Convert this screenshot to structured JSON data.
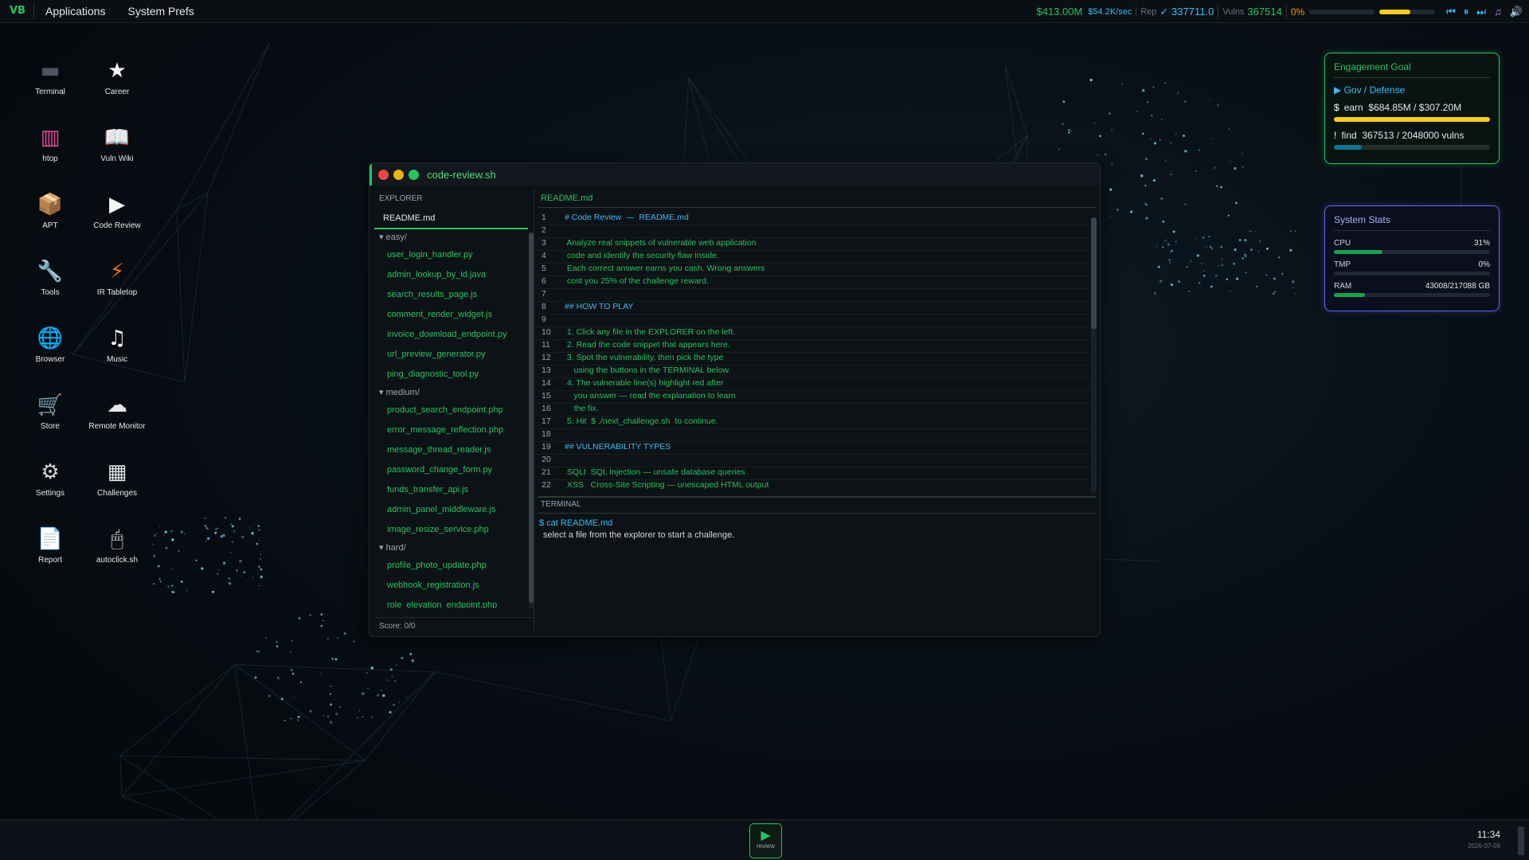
{
  "topbar": {
    "logo": "VB",
    "menu": [
      "Applications",
      "System Prefs"
    ],
    "money": "$413.00M",
    "rate": "$54.2K/sec",
    "rep_label": "Rep",
    "rep_value": "✓ 337711.0",
    "vulns_label": "Vulns",
    "vulns_value": "367514",
    "progress_pct": "0%",
    "progress_value": 0,
    "volume_level": 0.55,
    "media_icons": [
      "previous-icon",
      "pause-icon",
      "next-icon",
      "music-icon",
      "volume-icon"
    ]
  },
  "desktop_icons": [
    {
      "name": "terminal",
      "label": "Terminal",
      "glyph": "▬",
      "color": "#4b5563"
    },
    {
      "name": "career",
      "label": "Career",
      "glyph": "★",
      "color": "#f5f5f5"
    },
    {
      "name": "htop",
      "label": "htop",
      "glyph": "▥",
      "color": "#ec4899"
    },
    {
      "name": "vuln-wiki",
      "label": "Vuln Wiki",
      "glyph": "📖",
      "color": "#60a5fa"
    },
    {
      "name": "apt",
      "label": "APT",
      "glyph": "📦",
      "color": "#d97706"
    },
    {
      "name": "code-review",
      "label": "Code Review",
      "glyph": "▶",
      "color": "#f5f5f5"
    },
    {
      "name": "tools",
      "label": "Tools",
      "glyph": "🔧",
      "color": "#d1d5db"
    },
    {
      "name": "ir-tabletop",
      "label": "IR Tabletop",
      "glyph": "⚡",
      "color": "#f97316"
    },
    {
      "name": "browser",
      "label": "Browser",
      "glyph": "🌐",
      "color": "#60a5fa"
    },
    {
      "name": "music",
      "label": "Music",
      "glyph": "♫",
      "color": "#f5f5f5"
    },
    {
      "name": "store",
      "label": "Store",
      "glyph": "🛒",
      "color": "#d1d5db"
    },
    {
      "name": "remote-monitor",
      "label": "Remote Monitor",
      "glyph": "☁",
      "color": "#e5e7eb"
    },
    {
      "name": "settings",
      "label": "Settings",
      "glyph": "⚙",
      "color": "#d1d5db"
    },
    {
      "name": "challenges",
      "label": "Challenges",
      "glyph": "▦",
      "color": "#e5e7eb"
    },
    {
      "name": "report",
      "label": "Report",
      "glyph": "📄",
      "color": "#e5e7eb"
    },
    {
      "name": "autoclick",
      "label": "autoclick.sh",
      "glyph": "🖱",
      "color": "#e5e7eb"
    }
  ],
  "engagement_goal": {
    "title": "Engagement Goal",
    "track": "▶ Gov / Defense",
    "earn_prefix": "$",
    "earn_label": "earn",
    "earn_value": "$684.85M / $307.20M",
    "earn_progress": 1.0,
    "find_prefix": "!",
    "find_label": "find",
    "find_value": "367513 / 2048000 vulns",
    "find_progress": 0.18,
    "colors": {
      "border": "#22c55e",
      "earn_bar": "#facc15",
      "find_bar": "#0e7490"
    }
  },
  "system_stats": {
    "title": "System Stats",
    "cpu_label": "CPU",
    "cpu_value": "31%",
    "cpu_progress": 0.31,
    "tmp_label": "TMP",
    "tmp_value": "0%",
    "tmp_progress": 0,
    "ram_label": "RAM",
    "ram_value": "43008/217088 GB",
    "ram_progress": 0.2
  },
  "window": {
    "title": "code-review.sh",
    "explorer_header": "EXPLORER",
    "readme": "README.md",
    "folders": [
      {
        "label": "▾ easy/",
        "files": [
          "user_login_handler.py",
          "admin_lookup_by_id.java",
          "search_results_page.js",
          "comment_render_widget.js",
          "invoice_download_endpoint.py",
          "url_preview_generator.py",
          "ping_diagnostic_tool.py"
        ]
      },
      {
        "label": "▾ medium/",
        "files": [
          "product_search_endpoint.php",
          "error_message_reflection.php",
          "message_thread_reader.js",
          "password_change_form.py",
          "funds_transfer_api.js",
          "admin_panel_middleware.js",
          "image_resize_service.php"
        ]
      },
      {
        "label": "▾ hard/",
        "files": [
          "profile_photo_update.php",
          "webhook_registration.js",
          "role_elevation_endpoint.php"
        ]
      }
    ],
    "score": "Score: 0/0",
    "editor_tab": "README.md",
    "code_lines": [
      {
        "n": "1",
        "text": "# Code Review  —  README.md",
        "heading": true
      },
      {
        "n": "2",
        "text": ""
      },
      {
        "n": "3",
        "text": " Analyze real snippets of vulnerable web application"
      },
      {
        "n": "4",
        "text": " code and identify the security flaw inside."
      },
      {
        "n": "5",
        "text": " Each correct answer earns you cash. Wrong answers"
      },
      {
        "n": "6",
        "text": " cost you 25% of the challenge reward."
      },
      {
        "n": "7",
        "text": ""
      },
      {
        "n": "8",
        "text": "## HOW TO PLAY",
        "heading": true
      },
      {
        "n": "9",
        "text": ""
      },
      {
        "n": "10",
        "text": " 1. Click any file in the EXPLORER on the left."
      },
      {
        "n": "11",
        "text": " 2. Read the code snippet that appears here."
      },
      {
        "n": "12",
        "text": " 3. Spot the vulnerability, then pick the type"
      },
      {
        "n": "13",
        "text": "    using the buttons in the TERMINAL below."
      },
      {
        "n": "14",
        "text": " 4. The vulnerable line(s) highlight red after"
      },
      {
        "n": "15",
        "text": "    you answer — read the explanation to learn"
      },
      {
        "n": "16",
        "text": "    the fix."
      },
      {
        "n": "17",
        "text": " 5. Hit  $ ./next_challenge.sh  to continue."
      },
      {
        "n": "18",
        "text": ""
      },
      {
        "n": "19",
        "text": "## VULNERABILITY TYPES",
        "heading": true
      },
      {
        "n": "20",
        "text": ""
      },
      {
        "n": "21",
        "text": " SQLI  SQL Injection — unsafe database queries"
      },
      {
        "n": "22",
        "text": " XSS   Cross-Site Scripting — unescaped HTML output"
      }
    ],
    "terminal_header": "TERMINAL",
    "terminal_cmd": "$ cat README.md",
    "terminal_out": "select a file from the explorer to start a challenge."
  },
  "taskbar": {
    "active_task": "review",
    "time": "11:34",
    "date": "2026-07-09"
  }
}
